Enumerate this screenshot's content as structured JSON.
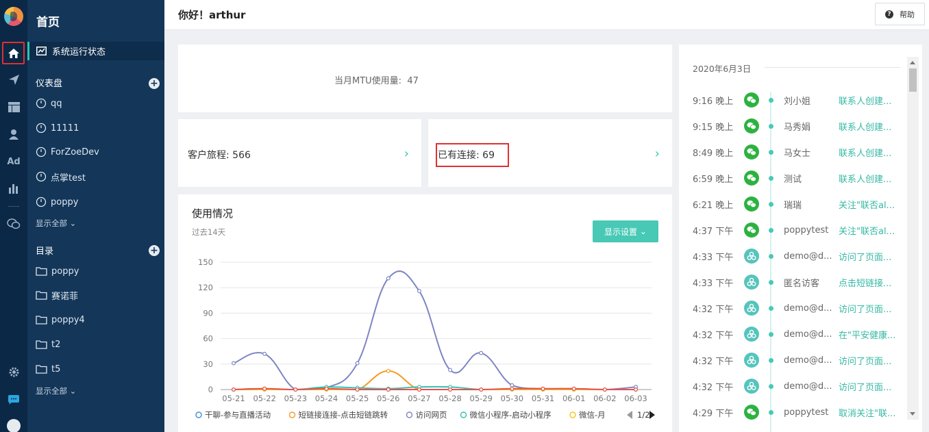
{
  "header": {
    "greeting": "你好！arthur",
    "help_label": "帮助"
  },
  "sidebar": {
    "title": "首页",
    "active_item": "系统运行状态",
    "dashboard_section": "仪表盘",
    "dashboards": [
      "qq",
      "11111",
      "ForZoeDev",
      "点掌test",
      "poppy"
    ],
    "show_all": "显示全部",
    "catalog_section": "目录",
    "folders": [
      "poppy",
      "赛诺菲",
      "poppy4",
      "t2",
      "t5"
    ]
  },
  "rail": {
    "icons": [
      "home-icon",
      "send-icon",
      "layout-icon",
      "user-icon",
      "ad-icon",
      "bar-chart-icon",
      "wechat-icon",
      "gear-icon",
      "chat-bubble-icon",
      "avatar"
    ],
    "ad_label": "Ad"
  },
  "mtu": {
    "label": "当月MTU使用量:",
    "value": "47"
  },
  "stats": {
    "journey": "客户旅程: 566",
    "connections": "已有连接: 69"
  },
  "usage": {
    "title": "使用情况",
    "subtitle": "过去14天",
    "display_button": "显示设置",
    "pagination": "1/2"
  },
  "chart_data": {
    "type": "line",
    "categories": [
      "05-21",
      "05-22",
      "05-23",
      "05-24",
      "05-25",
      "05-26",
      "05-27",
      "05-28",
      "05-29",
      "05-30",
      "05-31",
      "06-01",
      "06-02",
      "06-03"
    ],
    "ylim": [
      0,
      150
    ],
    "yticks": [
      0,
      30,
      60,
      90,
      120,
      150
    ],
    "grid": true,
    "legend_position": "bottom",
    "series": [
      {
        "name": "干聊-参与直播活动",
        "color": "#3f8fd2",
        "values": [
          0,
          0,
          0,
          0,
          0,
          0,
          0,
          0,
          0,
          0,
          0,
          0,
          0,
          0
        ]
      },
      {
        "name": "短链接连接-点击短链跳转",
        "color": "#f59a23",
        "values": [
          0,
          0,
          0,
          0,
          0,
          22,
          0,
          0,
          0,
          0,
          0,
          0,
          0,
          0
        ]
      },
      {
        "name": "访问网页",
        "color": "#7d85c2",
        "values": [
          31,
          42,
          0,
          2,
          31,
          131,
          116,
          23,
          43,
          5,
          1,
          1,
          0,
          3
        ]
      },
      {
        "name": "微信小程序-启动小程序",
        "color": "#35c0b2",
        "values": [
          0,
          1,
          0,
          3,
          2,
          1,
          3,
          3,
          0,
          0,
          0,
          0,
          0,
          0
        ]
      },
      {
        "name": "微信-月",
        "color": "#f5c518",
        "values": [
          0,
          0,
          0,
          0,
          0,
          0,
          0,
          0,
          0,
          0,
          0,
          0,
          0,
          0
        ]
      },
      {
        "name": "",
        "color": "#e85050",
        "values": [
          0,
          1,
          0,
          1,
          0,
          0,
          0,
          0,
          0,
          1,
          1,
          1,
          0,
          0
        ]
      }
    ]
  },
  "feed": {
    "date": "2020年6月3日",
    "rows": [
      {
        "time": "9:16 晚上",
        "type": "wx",
        "name": "刘小姐",
        "action": "联系人创建..."
      },
      {
        "time": "9:15 晚上",
        "type": "wx",
        "name": "马秀娟",
        "action": "联系人创建..."
      },
      {
        "time": "8:49 晚上",
        "type": "wx",
        "name": "马女士",
        "action": "联系人创建..."
      },
      {
        "time": "6:59 晚上",
        "type": "wx",
        "name": "测试",
        "action": "联系人创建..."
      },
      {
        "time": "6:21 晚上",
        "type": "wx",
        "name": "瑞瑞",
        "action": "关注\"联否al..."
      },
      {
        "time": "4:37 下午",
        "type": "wx",
        "name": "poppytest",
        "action": "关注\"联否al..."
      },
      {
        "time": "4:33 下午",
        "type": "web",
        "name": "demo@d...",
        "action": "访问了页面..."
      },
      {
        "time": "4:33 下午",
        "type": "web",
        "name": "匿名访客",
        "action": "点击短链接..."
      },
      {
        "time": "4:32 下午",
        "type": "web",
        "name": "demo@d...",
        "action": "访问了页面..."
      },
      {
        "time": "4:32 下午",
        "type": "web",
        "name": "demo@d...",
        "action": "在\"平安健康..."
      },
      {
        "time": "4:32 下午",
        "type": "web",
        "name": "demo@d...",
        "action": "访问了页面..."
      },
      {
        "time": "4:32 下午",
        "type": "web",
        "name": "demo@d...",
        "action": "访问了页面..."
      },
      {
        "time": "4:29 下午",
        "type": "wx",
        "name": "poppytest",
        "action": "取消关注\"联..."
      }
    ]
  }
}
